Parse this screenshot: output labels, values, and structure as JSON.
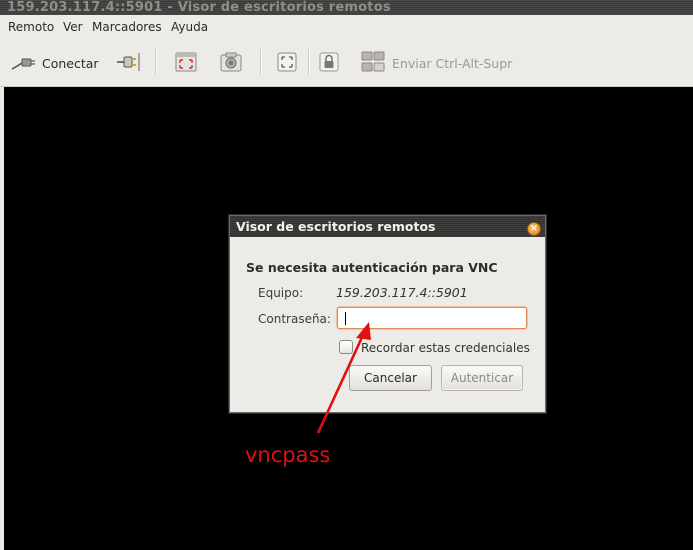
{
  "window": {
    "title": "159.203.117.4::5901 - Visor de escritorios remotos"
  },
  "menubar": {
    "items": [
      "Remoto",
      "Ver",
      "Marcadores",
      "Ayuda"
    ]
  },
  "toolbar": {
    "connect_label": "Conectar",
    "send_keys_label": "Enviar Ctrl-Alt-Supr",
    "icons": [
      "connect-icon",
      "disconnect-plug-icon",
      "fullscreen-icon",
      "screenshot-icon",
      "fit-screen-icon",
      "lock-icon",
      "send-keys-icon"
    ]
  },
  "dialog": {
    "title": "Visor de escritorios remotos",
    "heading": "Se necesita autenticación para VNC",
    "host_label": "Equipo:",
    "host_value": "159.203.117.4::5901",
    "password_label": "Contraseña:",
    "password_value": "",
    "remember_label": "Recordar estas credenciales",
    "remember_checked": false,
    "cancel_label": "Cancelar",
    "auth_label": "Autenticar"
  },
  "annotation": {
    "text": "vncpass",
    "color": "#e01010"
  }
}
